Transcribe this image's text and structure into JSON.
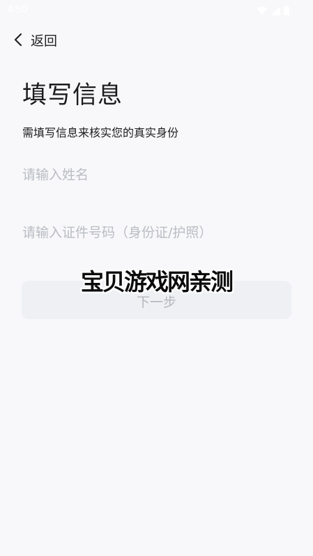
{
  "status_bar": {
    "time": "4:50",
    "icons": [
      "wifi-icon",
      "signal-icon",
      "battery-icon"
    ],
    "icon_color": "#ffffff"
  },
  "nav": {
    "back_label": "返回"
  },
  "header": {
    "title": "填写信息",
    "subtitle": "需填写信息来核实您的真实身份"
  },
  "form": {
    "name_placeholder": "请输入姓名",
    "name_value": "",
    "id_placeholder": "请输入证件号码（身份证/护照）",
    "id_value": "",
    "next_label": "下一步"
  },
  "watermark": {
    "text": "宝贝游戏网亲测"
  },
  "colors": {
    "background": "#f8f8fa",
    "button_bg": "#eef0f4",
    "button_text": "#b3b6bd",
    "placeholder": "#b9bcc3"
  }
}
